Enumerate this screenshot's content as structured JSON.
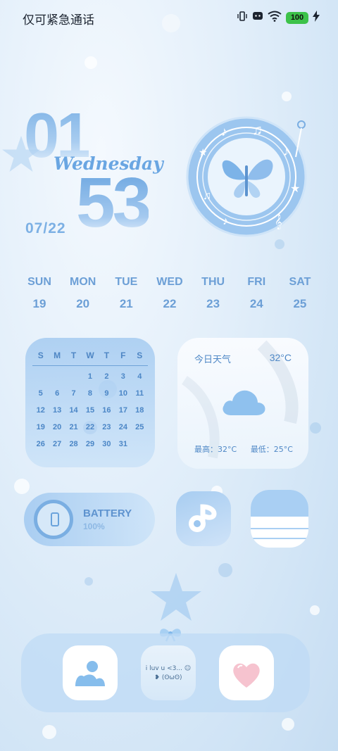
{
  "status_bar": {
    "carrier_text": "仅可紧急通话",
    "battery_level": "100",
    "icons": [
      "vibrate-icon",
      "notification-icon",
      "wifi-icon",
      "battery-icon",
      "charging-icon"
    ]
  },
  "clock": {
    "hour": "01",
    "minute": "53",
    "weekday": "Wednesday",
    "date": "07/22"
  },
  "week": [
    {
      "day": "SUN",
      "num": "19"
    },
    {
      "day": "MON",
      "num": "20"
    },
    {
      "day": "TUE",
      "num": "21"
    },
    {
      "day": "WED",
      "num": "22"
    },
    {
      "day": "THU",
      "num": "23"
    },
    {
      "day": "FRI",
      "num": "24"
    },
    {
      "day": "SAT",
      "num": "25"
    }
  ],
  "calendar": {
    "headers": [
      "S",
      "M",
      "T",
      "W",
      "T",
      "F",
      "S"
    ],
    "cells": [
      "",
      "",
      "",
      "1",
      "2",
      "3",
      "4",
      "5",
      "6",
      "7",
      "8",
      "9",
      "10",
      "11",
      "12",
      "13",
      "14",
      "15",
      "16",
      "17",
      "18",
      "19",
      "20",
      "21",
      "22",
      "23",
      "24",
      "25",
      "26",
      "27",
      "28",
      "29",
      "30",
      "31",
      ""
    ],
    "today": "22"
  },
  "weather": {
    "title": "今日天气",
    "temp": "32°C",
    "high": "最高：32°C",
    "low": "最低：25°C",
    "condition_icon": "cloud-icon"
  },
  "battery_widget": {
    "label": "BATTERY",
    "percent": "100%"
  },
  "dock": {
    "note_line1": "i luv u <3... ☺",
    "note_line2": "❥ (ʘωʘ)"
  },
  "colors": {
    "accent": "#6aa6e2",
    "widget_bg": "#b9d6f3",
    "status_green": "#3cc24a"
  }
}
